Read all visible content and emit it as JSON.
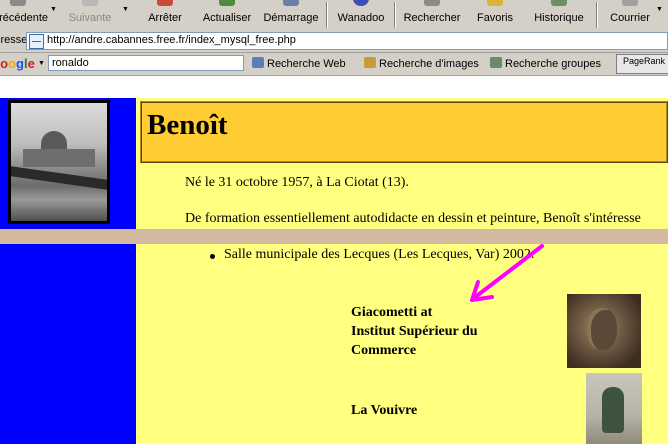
{
  "toolbar": {
    "buttons": [
      {
        "label": "Précédente"
      },
      {
        "label": "Suivante"
      },
      {
        "label": "Arrêter"
      },
      {
        "label": "Actualiser"
      },
      {
        "label": "Démarrage"
      },
      {
        "label": "Wanadoo"
      },
      {
        "label": "Rechercher"
      },
      {
        "label": "Favoris"
      },
      {
        "label": "Historique"
      },
      {
        "label": "Courrier"
      }
    ]
  },
  "address": {
    "label": "Adresse",
    "url": "http://andre.cabannes.free.fr/index_mysql_free.php"
  },
  "google": {
    "logo": "Google",
    "query": "ronaldo",
    "buttons": [
      "Recherche Web",
      "Recherche d'images",
      "Recherche groupes"
    ],
    "pagerank": "PageRank"
  },
  "page": {
    "title": "Benoît",
    "birth": "Né le 31 octobre 1957, à La Ciotat (13).",
    "training": "De formation essentiellement autodidacte en dessin et peinture, Benoît s'intéresse",
    "exhibition": "Salle municipale des Lecques (Les Lecques, Var) 2002.",
    "works": [
      {
        "title_lines": [
          "Giacometti at",
          "Institut Supérieur du",
          "Commerce"
        ]
      },
      {
        "title_lines": [
          "La Vouivre"
        ]
      }
    ]
  },
  "colors": {
    "left_column": "#0000ff",
    "content_bg": "#ffff80",
    "title_bg": "#ffcc33",
    "band": "#d2b9a0",
    "arrow": "#ff00ff"
  }
}
